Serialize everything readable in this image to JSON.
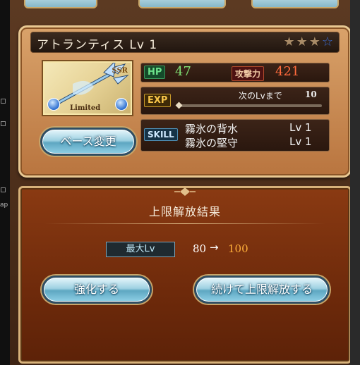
{
  "sidebar": {
    "fragment_text": "ap"
  },
  "weapon": {
    "title": "アトランティス Lv 1",
    "stars_filled": 3,
    "stars_total": 4,
    "rarity": "SSR",
    "limited_label": "Limited",
    "icon": "trident-weapon-icon"
  },
  "stats": {
    "hp_label": "HP",
    "hp_value": "47",
    "atk_label": "攻撃力",
    "atk_value": "421",
    "exp_label": "EXP",
    "next_lv_label": "次のLvまで",
    "next_lv_value": "10",
    "skill_label": "SKILL",
    "skills": [
      {
        "name": "霧氷の背水",
        "level": "Lv 1"
      },
      {
        "name": "霧氷の堅守",
        "level": "Lv 1"
      }
    ]
  },
  "buttons": {
    "change_base": "ベース変更",
    "enhance": "強化する",
    "continue_uncap": "続けて上限解放する"
  },
  "result": {
    "title": "上限解放結果",
    "max_lv_label": "最大Lv",
    "from": "80",
    "arrow": "→",
    "to": "100"
  },
  "colors": {
    "hp": "#7fdc72",
    "atk": "#ff6b3d",
    "lv_to": "#ffb03b",
    "panel_brown": "#6e2a0b"
  }
}
